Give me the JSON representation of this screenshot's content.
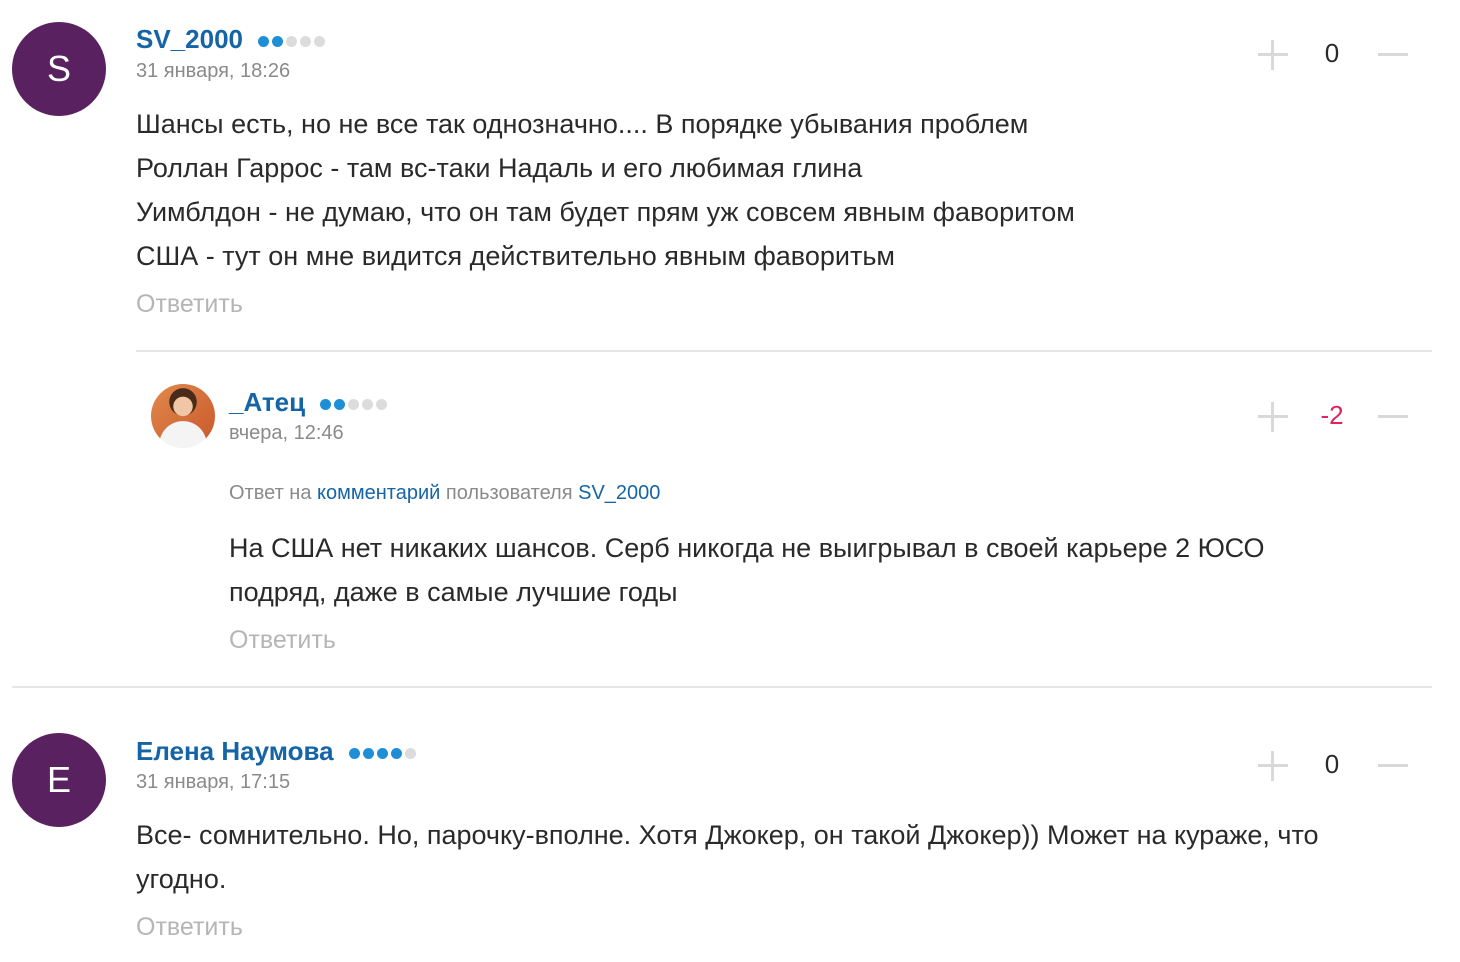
{
  "comments": [
    {
      "avatar_letter": "S",
      "username": "SV_2000",
      "rating_dots": [
        true,
        true,
        false,
        false,
        false
      ],
      "date": "31 января, 18:26",
      "score": "0",
      "lines": [
        "Шансы есть, но не все так однозначно.... В порядке убывания проблем",
        "Роллан Гаррос - там вс-таки Надаль и его любимая глина",
        "Уимблдон - не думаю, что он там будет прям уж совсем явным фаворитом",
        "США - тут он мне видится действительно явным фаворитьм"
      ],
      "reply_label": "Ответить"
    },
    {
      "username": "_Атец",
      "rating_dots": [
        true,
        true,
        false,
        false,
        false
      ],
      "date": "вчера, 12:46",
      "score": "-2",
      "reply_to": {
        "prefix": "Ответ на",
        "link": "комментарий",
        "middle": "пользователя",
        "user": "SV_2000"
      },
      "lines": [
        "На США нет никаких шансов. Серб никогда не выигрывал в своей карьере 2 ЮСО",
        "подряд, даже в самые лучшие годы"
      ],
      "reply_label": "Ответить"
    },
    {
      "avatar_letter": "Е",
      "username": "Елена Наумова",
      "rating_dots": [
        true,
        true,
        true,
        true,
        false
      ],
      "date": "31 января, 17:15",
      "score": "0",
      "lines": [
        "Все- сомнительно. Но, парочку-вполне. Хотя Джокер, он такой Джокер)) Может на кураже, что",
        "угодно."
      ],
      "reply_label": "Ответить"
    }
  ],
  "icons": {
    "upvote": "plus-icon",
    "downvote": "minus-icon"
  },
  "colors": {
    "avatar_bg": "#5a2160",
    "username": "#1565a6",
    "dot_active": "#1e8fd6",
    "negative_score": "#e0245e"
  }
}
